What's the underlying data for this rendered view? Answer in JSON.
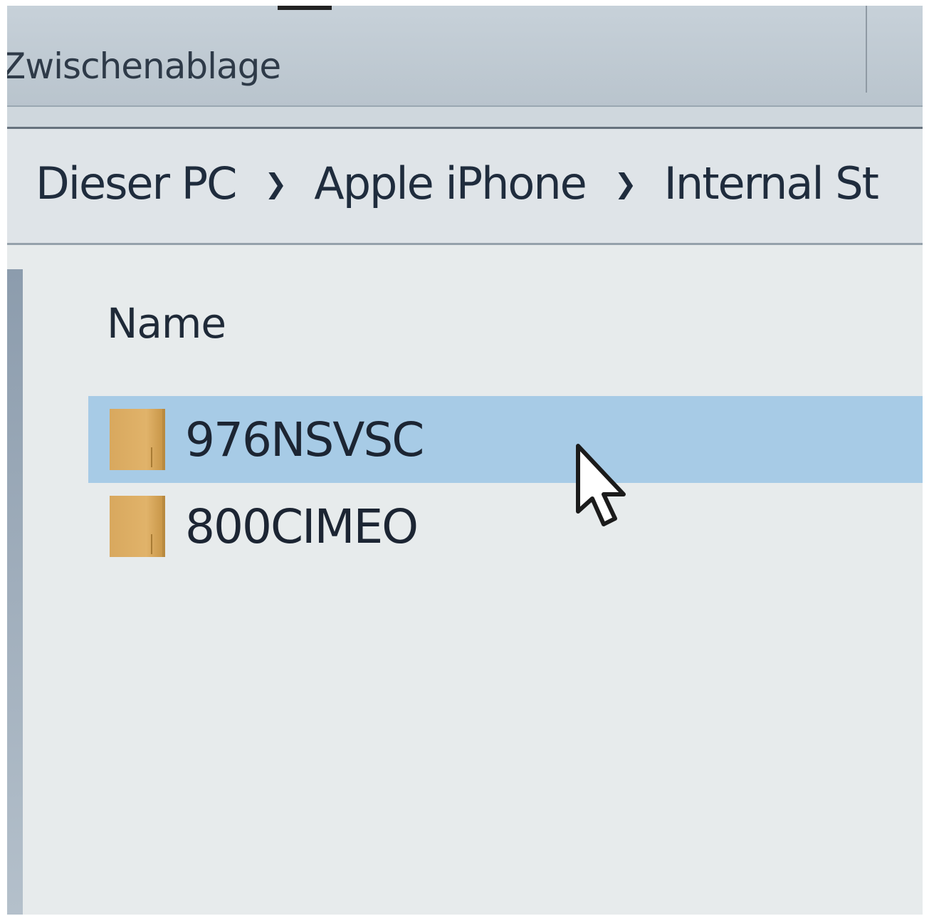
{
  "ribbon": {
    "group_label": "Zwischenablage"
  },
  "breadcrumb": {
    "items": [
      "Dieser PC",
      "Apple iPhone",
      "Internal St"
    ],
    "separator": "›"
  },
  "file_list": {
    "column_header": "Name",
    "items": [
      {
        "name": "976NSVSC",
        "type": "folder",
        "selected": true
      },
      {
        "name": "800CIMEO",
        "type": "folder",
        "selected": false
      }
    ]
  },
  "icons": {
    "folder": "folder-icon",
    "cursor": "mouse-pointer-icon"
  },
  "colors": {
    "selection": "#a7cbe6",
    "folder": "#e1b36a"
  }
}
